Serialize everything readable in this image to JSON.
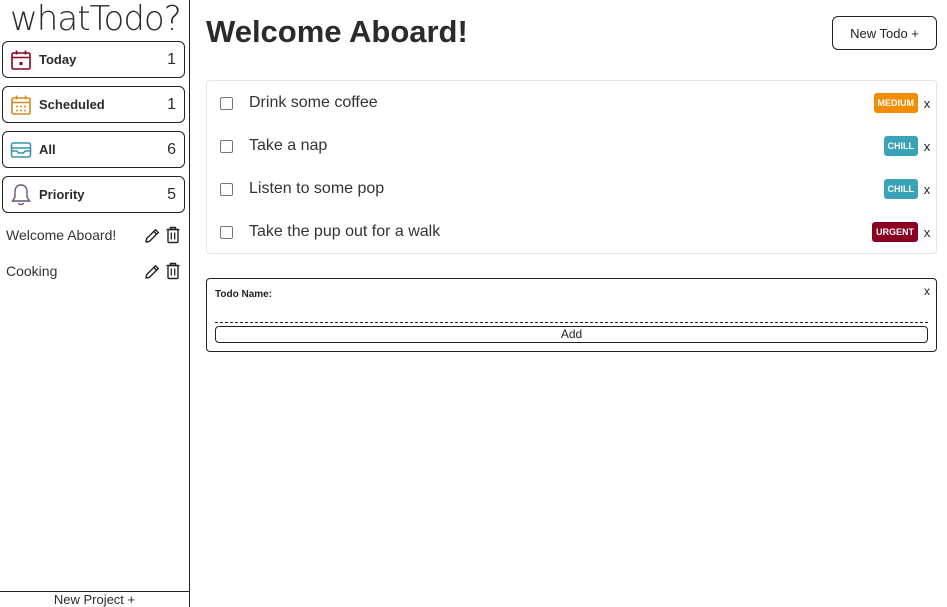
{
  "app": {
    "logo": "whatTodo?"
  },
  "sidebar": {
    "nav": [
      {
        "label": "Today",
        "count": "1",
        "icon": "calendar-day-icon",
        "color": "#8b0021"
      },
      {
        "label": "Scheduled",
        "count": "1",
        "icon": "calendar-grid-icon",
        "color": "#d98a1a"
      },
      {
        "label": "All",
        "count": "6",
        "icon": "inbox-tray-icon",
        "color": "#3a94aa"
      },
      {
        "label": "Priority",
        "count": "5",
        "icon": "bell-icon",
        "color": "#6b4f7c"
      }
    ],
    "projects": [
      {
        "name": "Welcome Aboard!"
      },
      {
        "name": "Cooking"
      }
    ],
    "new_project_label": "New Project +"
  },
  "main": {
    "title": "Welcome Aboard!",
    "new_todo_label": "New Todo +",
    "todos": [
      {
        "name": "Drink some coffee",
        "priority": "MEDIUM",
        "priority_color": "#f28c00",
        "delete_label": "x"
      },
      {
        "name": "Take a nap",
        "priority": "CHILL",
        "priority_color": "#3ba3b8",
        "delete_label": "x"
      },
      {
        "name": "Listen to some pop",
        "priority": "CHILL",
        "priority_color": "#3ba3b8",
        "delete_label": "x"
      },
      {
        "name": "Take the pup out for a walk",
        "priority": "URGENT",
        "priority_color": "#8b0021",
        "delete_label": "x"
      }
    ],
    "form": {
      "label": "Todo Name:",
      "close_label": "x",
      "input_value": "",
      "add_label": "Add"
    }
  }
}
